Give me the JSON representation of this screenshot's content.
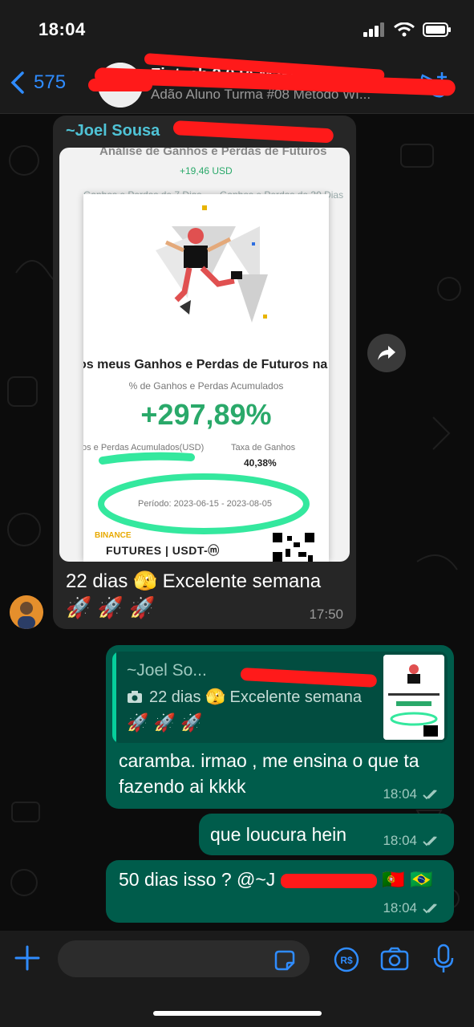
{
  "status_bar": {
    "time": "18:04"
  },
  "header": {
    "back_count": "575",
    "group_title": "Fintech 2.0 IA Make Mon...",
    "group_subtitle": "Adão Aluno Turma #08 Metodo WI..."
  },
  "incoming_message": {
    "sender": "~Joel Sousa",
    "caption_line1": "22 dias 🫣 Excelente semana",
    "caption_line2": "🚀 🚀 🚀",
    "time": "17:50",
    "media": {
      "background_title": "Análise de Ganhos e Perdas de Futuros",
      "background_value": "+19,46 USD",
      "background_tab1": "Ganhos e Perdas de 7 Dias",
      "background_tab2": "Ganhos e Perdas de 30 Dias",
      "card_headline": "os meus Ganhos e Perdas de Futuros na",
      "card_subheadline": "% de Ganhos e Perdas Acumulados",
      "card_percent": "+297,89%",
      "card_label_left": "os e Perdas Acumulados(USD)",
      "card_label_right": "Taxa de Ganhos",
      "card_rate": "40,38%",
      "card_period": "Período: 2023-06-15 - 2023-08-05",
      "brand": "BINANCE",
      "product": "FUTURES | USDT-ⓜ"
    }
  },
  "outgoing_messages": [
    {
      "quote_name": "~Joel So...",
      "quote_text": "22 dias 🫣 Excelente semana",
      "quote_rockets": "🚀 🚀 🚀",
      "text": "caramba. irmao , me ensina o que ta fazendo ai kkkk",
      "time": "18:04"
    },
    {
      "text": "que loucura hein",
      "time": "18:04"
    },
    {
      "text": "50 dias isso ? @~J",
      "flags": "🇵🇹 🇧🇷",
      "time": "18:04"
    }
  ],
  "colors": {
    "accent_blue": "#2f8cff",
    "outgoing_bubble": "#005c4b",
    "incoming_bubble": "#262626",
    "binance_green": "#2aa96a",
    "redaction_red": "#ff1a1a"
  },
  "icons": [
    "back-chevron-icon",
    "add-call-icon",
    "forward-icon",
    "plus-icon",
    "sticker-icon",
    "pix-icon",
    "camera-icon",
    "mic-icon",
    "double-check-icon"
  ]
}
